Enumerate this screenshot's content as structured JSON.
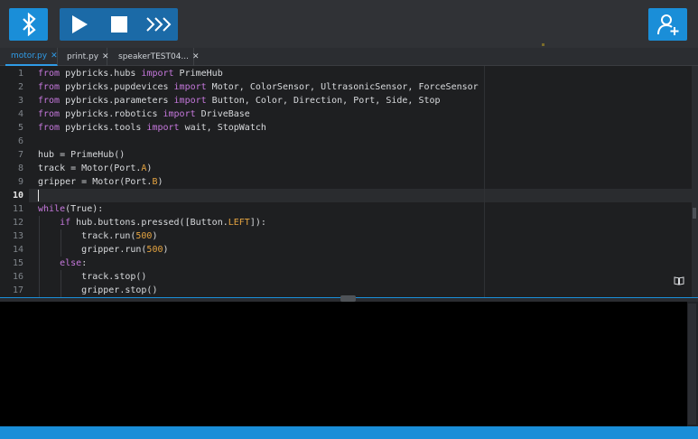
{
  "toolbar": {
    "bluetooth_icon": "bluetooth-icon",
    "run_icon": "play-icon",
    "stop_icon": "stop-icon",
    "repl_icon": "repl-chevrons-icon",
    "user_icon": "add-user-icon",
    "colors": {
      "accent": "#1a8ed8",
      "run_group": "#1b6aa7",
      "bar": "#303236"
    }
  },
  "tabs": [
    {
      "label": "motor.py",
      "close": "✕",
      "active": true
    },
    {
      "label": "print.py",
      "close": "✕",
      "active": false
    },
    {
      "label": "speakerTEST04...",
      "close": "✕",
      "active": false
    }
  ],
  "editor": {
    "current_line": 10,
    "line_numbers": [
      "1",
      "2",
      "3",
      "4",
      "5",
      "6",
      "7",
      "8",
      "9",
      "10",
      "11",
      "12",
      "13",
      "14",
      "15",
      "16",
      "17"
    ],
    "lines": [
      {
        "kw1": "from",
        "mid": " pybricks.hubs ",
        "kw2": "import",
        "rest": " PrimeHub"
      },
      {
        "kw1": "from",
        "mid": " pybricks.pupdevices ",
        "kw2": "import",
        "rest": " Motor, ColorSensor, UltrasonicSensor, ForceSensor"
      },
      {
        "kw1": "from",
        "mid": " pybricks.parameters ",
        "kw2": "import",
        "rest": " Button, Color, Direction, Port, Side, Stop"
      },
      {
        "kw1": "from",
        "mid": " pybricks.robotics ",
        "kw2": "import",
        "rest": " DriveBase"
      },
      {
        "kw1": "from",
        "mid": " pybricks.tools ",
        "kw2": "import",
        "rest": " wait, StopWatch"
      }
    ],
    "line7": {
      "a": "hub = PrimeHub()"
    },
    "line8": {
      "a": "track = Motor(Port.",
      "b": "A",
      "c": ")"
    },
    "line9": {
      "a": "gripper = Motor(Port.",
      "b": "B",
      "c": ")"
    },
    "line11": {
      "kw": "while",
      "rest": "(True):"
    },
    "line12": {
      "indent": "    ",
      "kw": "if",
      "a": " hub.buttons.pressed([Button.",
      "b": "LEFT",
      "c": "]):"
    },
    "line13": {
      "indent": "        ",
      "a": "track.run(",
      "b": "500",
      "c": ")"
    },
    "line14": {
      "indent": "        ",
      "a": "gripper.run(",
      "b": "500",
      "c": ")"
    },
    "line15": {
      "indent": "    ",
      "kw": "else",
      "rest": ":"
    },
    "line16": {
      "indent": "        ",
      "a": "track.stop()"
    },
    "line17": {
      "indent": "        ",
      "a": "gripper.stop()"
    },
    "doc_icon": "book-icon"
  },
  "terminal": {
    "content": ""
  }
}
